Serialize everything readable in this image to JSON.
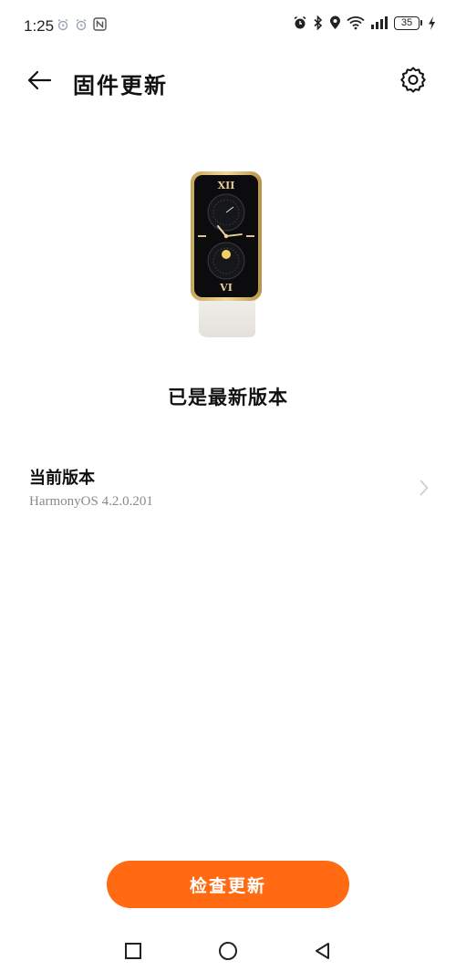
{
  "status_bar": {
    "time": "1:25",
    "battery_level": "35",
    "left_icons": [
      "alarm-icon",
      "alarm-icon",
      "nfc-icon"
    ],
    "right_icons": [
      "alarm-clock-icon",
      "bluetooth-icon",
      "location-icon",
      "wifi-icon",
      "signal-icon",
      "battery-icon",
      "charging-icon"
    ]
  },
  "header": {
    "title": "固件更新",
    "back_icon": "arrow-left-icon",
    "settings_icon": "gear-icon"
  },
  "device": {
    "image": "smart-band-watch-image",
    "roman_top": "XII",
    "roman_bottom": "VI"
  },
  "update_status": "已是最新版本",
  "version": {
    "label": "当前版本",
    "value": "HarmonyOS 4.2.0.201"
  },
  "check_button": {
    "label": "检查更新",
    "color": "#ff6a12"
  },
  "nav_bar": {
    "items": [
      "recents-square-icon",
      "home-circle-icon",
      "back-triangle-icon"
    ]
  }
}
